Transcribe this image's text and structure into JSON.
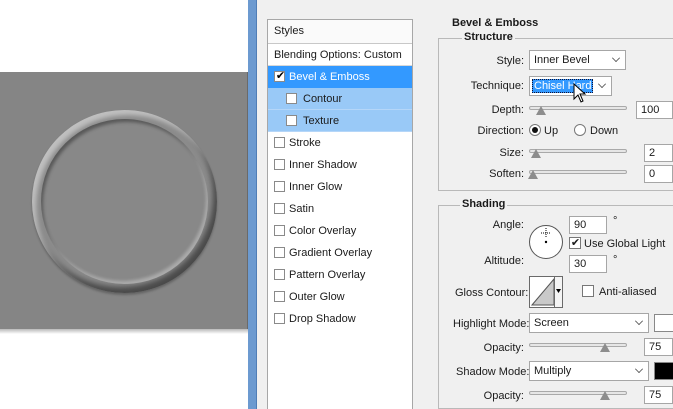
{
  "styles_panel": {
    "header": "Styles",
    "blending": "Blending Options: Custom",
    "items": [
      {
        "label": "Bevel & Emboss",
        "checked": true
      },
      {
        "label": "Contour",
        "checked": false
      },
      {
        "label": "Texture",
        "checked": false
      },
      {
        "label": "Stroke",
        "checked": false
      },
      {
        "label": "Inner Shadow",
        "checked": false
      },
      {
        "label": "Inner Glow",
        "checked": false
      },
      {
        "label": "Satin",
        "checked": false
      },
      {
        "label": "Color Overlay",
        "checked": false
      },
      {
        "label": "Gradient Overlay",
        "checked": false
      },
      {
        "label": "Pattern Overlay",
        "checked": false
      },
      {
        "label": "Outer Glow",
        "checked": false
      },
      {
        "label": "Drop Shadow",
        "checked": false
      }
    ],
    "check_glyph": "✔"
  },
  "bevel": {
    "title": "Bevel & Emboss",
    "structure_title": "Structure",
    "style_label": "Style:",
    "style_value": "Inner Bevel",
    "technique_label": "Technique:",
    "technique_value": "Chisel Hard",
    "depth_label": "Depth:",
    "depth_value": "100",
    "direction_label": "Direction:",
    "direction_up": "Up",
    "direction_down": "Down",
    "direction_selected": "Up",
    "size_label": "Size:",
    "size_value": "2",
    "soften_label": "Soften:",
    "soften_value": "0"
  },
  "shading": {
    "title": "Shading",
    "angle_label": "Angle:",
    "angle_value": "90",
    "degree_symbol": "°",
    "use_global_light_label": "Use Global Light",
    "use_global_light": true,
    "altitude_label": "Altitude:",
    "altitude_value": "30",
    "gloss_contour_label": "Gloss Contour:",
    "anti_aliased_label": "Anti-aliased",
    "anti_aliased": false,
    "highlight_mode_label": "Highlight Mode:",
    "highlight_mode_value": "Screen",
    "highlight_opacity_label": "Opacity:",
    "highlight_opacity_value": "75",
    "shadow_mode_label": "Shadow Mode:",
    "shadow_mode_value": "Multiply",
    "shadow_opacity_label": "Opacity:",
    "shadow_opacity_value": "75",
    "highlight_color": "#ffffff",
    "shadow_color": "#000000"
  },
  "colors": {
    "selection": "#3399ff",
    "subselection": "#99c9f7",
    "canvas": "#858585"
  }
}
